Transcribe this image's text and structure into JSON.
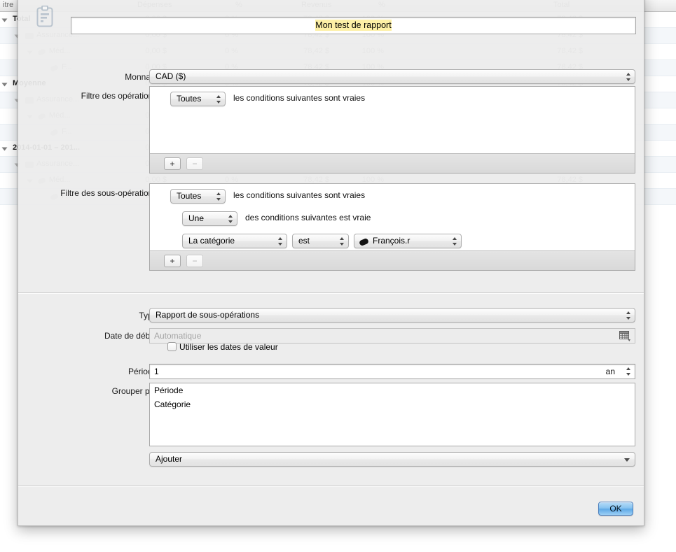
{
  "background": {
    "columns": [
      "itre",
      "Dépenses",
      "%",
      "Revenus",
      "%",
      "Total"
    ],
    "rows": [
      {
        "indent": 0,
        "label": "Total",
        "icon": "disclosure-triangle",
        "depenses": "0,00 $",
        "pct1": "0 %",
        "revenus": "78,42 $",
        "pct2": "100 %",
        "total": "78,42 $",
        "strong": true
      },
      {
        "indent": 1,
        "label": "Assurance...",
        "icon": "account-icon",
        "depenses": "0,00 $",
        "pct1": "0 %",
        "revenus": "78,42 $",
        "pct2": "100 %",
        "total": "78,42 $",
        "strong": false
      },
      {
        "indent": 2,
        "label": "Méd...",
        "icon": "category-icon",
        "depenses": "0,00 $",
        "pct1": "0 %",
        "revenus": "78,42 $",
        "pct2": "100 %",
        "total": "78,42 $",
        "strong": false
      },
      {
        "indent": 3,
        "label": "F...",
        "icon": "category-icon",
        "depenses": "0,00 $",
        "pct1": "0 %",
        "revenus": "78,42 $",
        "pct2": "100 %",
        "total": "78,42 $",
        "strong": false
      },
      {
        "indent": 0,
        "label": "Moyenne",
        "icon": "disclosure-triangle",
        "depenses": "0,00 $",
        "pct1": "0 %",
        "revenus": "78,42 $",
        "pct2": "100 %",
        "total": "78,42 $",
        "strong": true
      },
      {
        "indent": 1,
        "label": "Assurance...",
        "icon": "account-icon",
        "depenses": "0,00 $",
        "pct1": "0 %",
        "revenus": "78,42 $",
        "pct2": "100 %",
        "total": "78,42 $",
        "strong": false
      },
      {
        "indent": 2,
        "label": "Méd...",
        "icon": "category-icon",
        "depenses": "0,00 $",
        "pct1": "0 %",
        "revenus": "78,42 $",
        "pct2": "100 %",
        "total": "78,42 $",
        "strong": false
      },
      {
        "indent": 3,
        "label": "F...",
        "icon": "category-icon",
        "depenses": "0,00 $",
        "pct1": "0 %",
        "revenus": "78,42 $",
        "pct2": "100 %",
        "total": "78,42 $",
        "strong": false
      },
      {
        "indent": 0,
        "label": "2014-01-01 – 201...",
        "icon": "disclosure-triangle",
        "depenses": "0,00 $",
        "pct1": "0 %",
        "revenus": "78,42 $",
        "pct2": "100 %",
        "total": "78,42 $",
        "strong": true
      },
      {
        "indent": 1,
        "label": "Assurance...",
        "icon": "account-icon",
        "depenses": "0,00 $",
        "pct1": "0 %",
        "revenus": "78,42 $",
        "pct2": "100 %",
        "total": "78,42 $",
        "strong": false
      },
      {
        "indent": 2,
        "label": "Méd...",
        "icon": "category-icon",
        "depenses": "0,00 $",
        "pct1": "0 %",
        "revenus": "78,42 $",
        "pct2": "100 %",
        "total": "78,42 $",
        "strong": false
      },
      {
        "indent": 3,
        "label": "F...",
        "icon": "category-icon",
        "depenses": "0,00 $",
        "pct1": "0 %",
        "revenus": "78,42 $",
        "pct2": "100 %",
        "total": "78,42 $",
        "strong": false
      }
    ]
  },
  "sheet": {
    "icon": "clipboard-report-icon",
    "title": {
      "value": "Mon test de rapport",
      "highlight_color": "#fdf0a6"
    },
    "currency": {
      "label": "Monnaie :",
      "value": "CAD ($)"
    },
    "operations_filter": {
      "label": "Filtre des opérations :",
      "rows": [
        {
          "match": "Toutes",
          "text": "les conditions suivantes sont vraies"
        }
      ],
      "add_label": "+",
      "remove_label": "−"
    },
    "suboperations_filter": {
      "label": "Filtre des sous-opérations :",
      "rows": [
        {
          "match": "Toutes",
          "text": "les conditions suivantes sont vraies"
        },
        {
          "match": "Une",
          "text": "des conditions suivantes est vraie"
        }
      ],
      "condition": {
        "field": "La catégorie",
        "operator": "est",
        "value": "François.r",
        "value_icon": "category-pill-icon"
      },
      "add_label": "+",
      "remove_label": "−"
    },
    "type": {
      "label": "Type :",
      "value": "Rapport de sous-opérations"
    },
    "start_date": {
      "label": "Date de début :",
      "placeholder": "Automatique",
      "value": "",
      "picker_icon": "calendar-icon"
    },
    "value_dates_checkbox": {
      "label": "Utiliser les dates de valeur",
      "checked": false
    },
    "period": {
      "label": "Période :",
      "value": "1",
      "unit": "an"
    },
    "group_by": {
      "label": "Grouper par :",
      "items": [
        "Période",
        "Catégorie"
      ],
      "add_popup": "Ajouter"
    },
    "ok_button": "OK"
  }
}
